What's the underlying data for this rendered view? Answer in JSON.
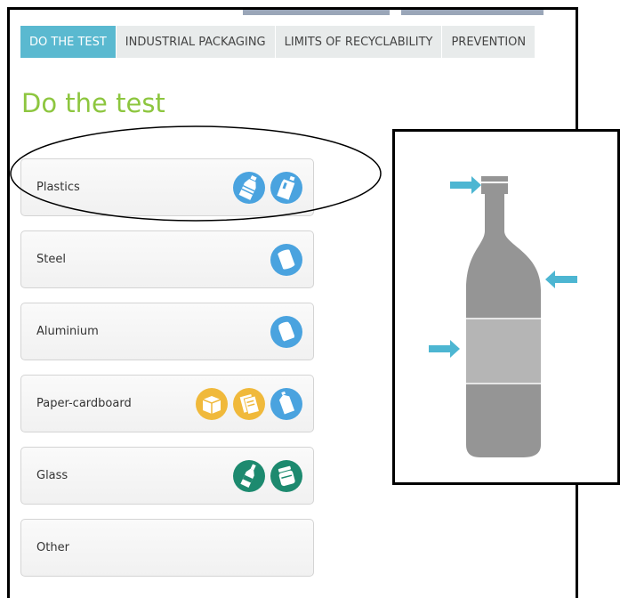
{
  "tabs": [
    {
      "label": "DO THE TEST"
    },
    {
      "label": "INDUSTRIAL PACKAGING"
    },
    {
      "label": "LIMITS OF RECYCLABILITY"
    },
    {
      "label": "PREVENTION"
    }
  ],
  "page_title": "Do the test",
  "categories": [
    {
      "label": "Plastics",
      "icons": [
        "plastic-bottle-icon",
        "detergent-bottle-icon"
      ]
    },
    {
      "label": "Steel",
      "icons": [
        "steel-can-icon"
      ]
    },
    {
      "label": "Aluminium",
      "icons": [
        "aluminium-can-icon"
      ]
    },
    {
      "label": "Paper-cardboard",
      "icons": [
        "cardboard-box-icon",
        "paper-icon",
        "beverage-carton-icon"
      ]
    },
    {
      "label": "Glass",
      "icons": [
        "glass-bottle-icon",
        "glass-jar-icon"
      ]
    },
    {
      "label": "Other",
      "icons": []
    }
  ],
  "colors": {
    "active_tab": "#5ab9d0",
    "title": "#8dc63f",
    "blue_icon": "#4aa3df",
    "yellow_icon": "#f0b93b",
    "green_icon": "#1d8a6f",
    "arrow": "#4db6d2",
    "bottle": "#959595",
    "label_band": "#b5b5b5"
  }
}
